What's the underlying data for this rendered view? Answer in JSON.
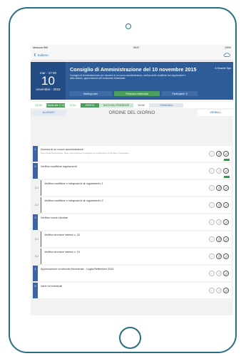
{
  "status": {
    "carrier": "Nessuna SIM",
    "time": "08:57",
    "battery": "100%"
  },
  "nav": {
    "back_label": "Indietro"
  },
  "header": {
    "date_top": "mar - 17:00",
    "day": "10",
    "month_year": "novembre - 2015",
    "title": "Consiglio di Amministrazione del 10 novembre 2015",
    "company": "A Smarter Spa",
    "description": "Consiglio di Amministrazione per ricevere di un nuovo amministratore, verifica delle modifiche dei regolamenti e dello statuto, approvazione del rendiconto trimestrale.",
    "btn_meeting": "Meeting room",
    "btn_presence": "Presenza confermata",
    "btn_participants": "Partecipanti",
    "participants_count": "8"
  },
  "timebar": {
    "start": "17:00",
    "seg1": "Fissata alle 17:00",
    "mid": "17:01",
    "seg3": "APERTA",
    "seg4": "RACCOGLI PRESENZE",
    "end": "19:00",
    "seg5": "CONCLUDI"
  },
  "tabs": {
    "left": "ALLEGATI",
    "center": "ORDINE DEL GIORNO",
    "right": "VERBALI"
  },
  "agenda": [
    {
      "num": "1",
      "title": "Nomina di un nuovo amministratore",
      "sub": "Fenomedia Documento: Reso approvazione consiglieri in condivisione di Smarter Verkvarkus",
      "badge": true
    },
    {
      "num": "2",
      "title": "Verifica modifiche regolamenti",
      "sub": "",
      "badge": true
    },
    {
      "num": "2.1",
      "title": "Verifica modifiche e integrazioni al regolamento 1",
      "sub": ""
    },
    {
      "num": "2.2",
      "title": "Verifica modifiche e integrazioni al regolamento 2",
      "sub": ""
    },
    {
      "num": "3",
      "title": "Verifica nuove circolari",
      "sub": ""
    },
    {
      "num": "3.1",
      "title": "Verifica circolare interna n. 32",
      "sub": ""
    },
    {
      "num": "3.2",
      "title": "Verifica circolare interna n. 10",
      "sub": ""
    },
    {
      "num": "4",
      "title": "Approvazione rendiconto trimestrale - Luglio/Settembre 2015",
      "sub": ""
    },
    {
      "num": "5",
      "title": "Varie ed eventuali",
      "sub": ""
    }
  ],
  "colors": {
    "frame": "#2a6f7f",
    "header_blue": "#2d5c98",
    "green": "#4aa05a"
  }
}
